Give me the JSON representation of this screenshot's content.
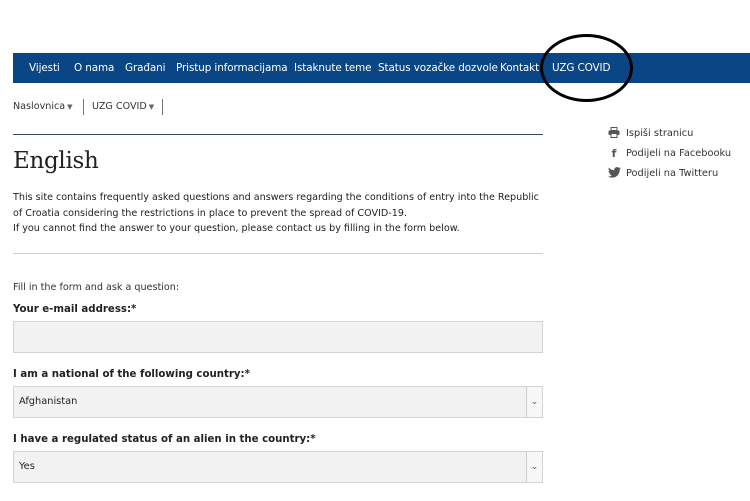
{
  "nav": {
    "items": [
      {
        "label": "Vijesti"
      },
      {
        "label": "O nama"
      },
      {
        "label": "Građani"
      },
      {
        "label": "Pristup informacijama"
      },
      {
        "label": "Istaknute teme"
      },
      {
        "label": "Status vozačke dozvole"
      },
      {
        "label": "Kontakt"
      },
      {
        "label": "UZG COVID"
      }
    ],
    "active": "UZG COVID"
  },
  "breadcrumb": [
    {
      "label": "Naslovnica"
    },
    {
      "label": "UZG COVID"
    }
  ],
  "page": {
    "title": "English",
    "intro_lines": [
      "This site contains frequently asked questions and answers regarding the conditions of entry into the Republic of Croatia considering the restrictions in place to prevent the spread of COVID-19.",
      "If you cannot find the answer to your question, please contact us by filling in the form below."
    ]
  },
  "form": {
    "intro": "Fill in the form and ask a question:",
    "email_label": "Your e-mail address:*",
    "email_value": "",
    "country_label": "I am a national of the following country:*",
    "country_value": "Afghanistan",
    "status_label": "I have a regulated status of an alien in the country:*",
    "status_value": "Yes"
  },
  "sidebar": {
    "print": "Ispiši stranicu",
    "facebook": "Podijeli na Facebooku",
    "twitter": "Podijeli na Twitteru"
  },
  "colors": {
    "nav_bg": "#0a4685",
    "rule": "#2d4a66"
  }
}
